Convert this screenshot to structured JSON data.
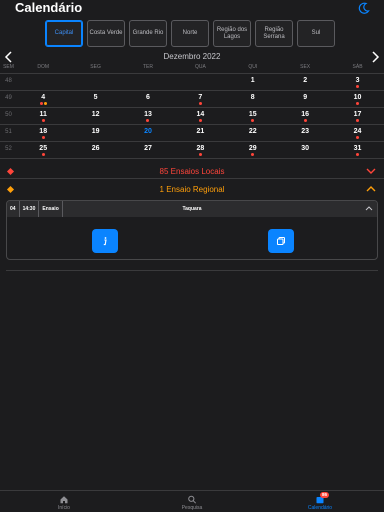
{
  "header": {
    "title": "Calendário"
  },
  "regions": [
    {
      "label": "Capital",
      "active": true
    },
    {
      "label": "Costa Verde",
      "active": false
    },
    {
      "label": "Grande Rio",
      "active": false
    },
    {
      "label": "Norte",
      "active": false
    },
    {
      "label": "Região dos Lagos",
      "active": false
    },
    {
      "label": "Região Serrana",
      "active": false
    },
    {
      "label": "Sul",
      "active": false
    }
  ],
  "calendar": {
    "month_label": "Dezembro 2022",
    "week_header": "SEM",
    "weekdays": [
      "DOM",
      "SEG",
      "TER",
      "QUA",
      "QUI",
      "SEX",
      "SÁB"
    ],
    "weeks": [
      {
        "num": "48",
        "days": [
          "",
          "",
          "",
          "",
          "1",
          "2",
          "3"
        ],
        "dots": [
          [],
          [],
          [],
          [],
          [],
          [],
          [
            "red"
          ]
        ]
      },
      {
        "num": "49",
        "days": [
          "4",
          "5",
          "6",
          "7",
          "8",
          "9",
          "10"
        ],
        "dots": [
          [
            "red",
            "orange"
          ],
          [],
          [],
          [
            "red"
          ],
          [],
          [],
          [
            "red"
          ]
        ]
      },
      {
        "num": "50",
        "days": [
          "11",
          "12",
          "13",
          "14",
          "15",
          "16",
          "17"
        ],
        "dots": [
          [
            "red"
          ],
          [],
          [
            "red"
          ],
          [
            "red"
          ],
          [
            "red"
          ],
          [
            "red"
          ],
          [
            "red"
          ]
        ]
      },
      {
        "num": "51",
        "days": [
          "18",
          "19",
          "20",
          "21",
          "22",
          "23",
          "24"
        ],
        "dots": [
          [
            "red"
          ],
          [],
          [],
          [],
          [],
          [],
          [
            "red"
          ]
        ]
      },
      {
        "num": "52",
        "days": [
          "25",
          "26",
          "27",
          "28",
          "29",
          "30",
          "31"
        ],
        "dots": [
          [
            "red"
          ],
          [],
          [],
          [
            "red"
          ],
          [
            "red"
          ],
          [],
          [
            "red"
          ]
        ]
      }
    ],
    "today": "20"
  },
  "sections": {
    "local": {
      "label": "85 Ensaios Locais",
      "color": "#ff453a"
    },
    "regional": {
      "label": "1 Ensaio Regional",
      "color": "#ff9f0a"
    }
  },
  "event": {
    "day": "04",
    "time": "14:30",
    "type": "Ensaio",
    "location": "Taquara"
  },
  "tabbar": {
    "items": [
      {
        "label": "Início",
        "icon": "home-icon",
        "active": false
      },
      {
        "label": "Pesquisa",
        "icon": "search-icon",
        "active": false
      },
      {
        "label": "Calendário",
        "icon": "calendar-icon",
        "active": true,
        "badge": "86"
      }
    ]
  },
  "colors": {
    "accent": "#0a84ff",
    "local": "#ff453a",
    "regional": "#ff9f0a",
    "background": "#1c1c1e"
  }
}
